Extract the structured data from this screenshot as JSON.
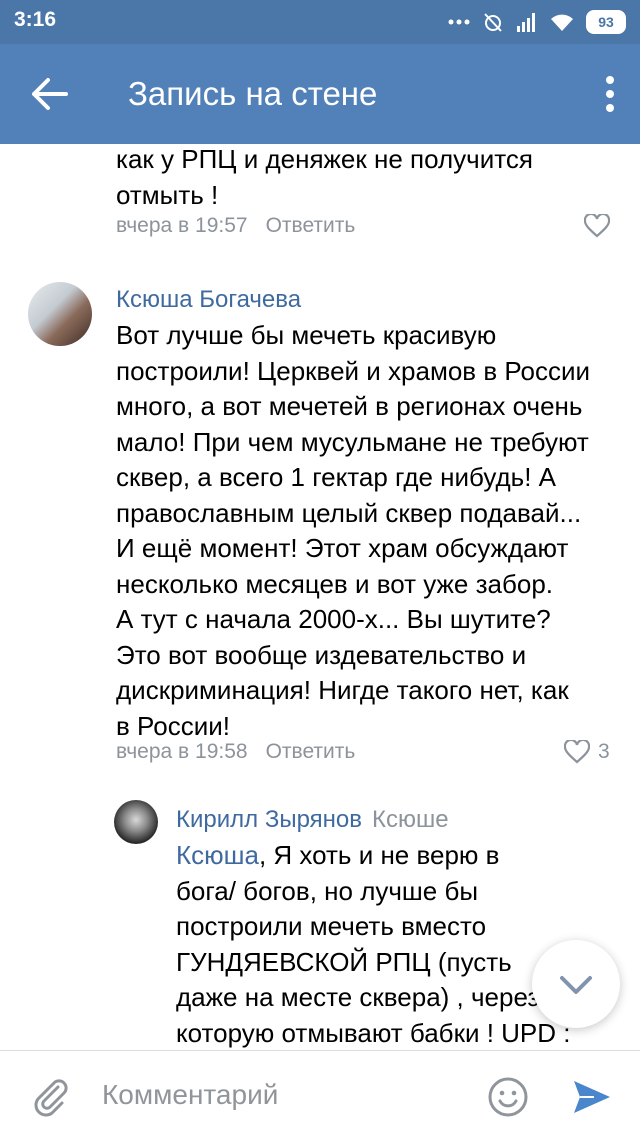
{
  "status": {
    "time": "3:16",
    "battery": "93"
  },
  "header": {
    "title": "Запись на стене"
  },
  "comments": [
    {
      "lines": [
        "как у РПЦ и деняжек не получится",
        "отмыть !"
      ],
      "time": "вчера в 19:57",
      "reply": "Ответить",
      "likes": ""
    },
    {
      "author": "Ксюша Богачева",
      "lines": [
        "Вот лучше бы мечеть красивую",
        "построили! Церквей и храмов в России",
        "много, а вот мечетей в регионах очень",
        "мало! При чем мусульмане не требуют",
        "сквер, а всего 1 гектар где нибудь! А",
        "православным целый сквер подавай...",
        "И ещё момент! Этот храм обсуждают",
        "несколько месяцев и вот уже забор.",
        "А тут с начала 2000-х... Вы шутите?",
        "Это вот вообще издевательство и",
        "дискриминация! Нигде такого нет, как",
        "в России!"
      ],
      "time": "вчера в 19:58",
      "reply": "Ответить",
      "likes": "3"
    },
    {
      "author": "Кирилл Зырянов",
      "reply_to": "Ксюше",
      "mention": "Ксюша",
      "first_line_rest": ", Я хоть и не верю в",
      "lines": [
        "бога/ богов, но лучше бы",
        "построили мечеть вместо",
        "ГУНДЯЕВСКОЙ РПЦ (пусть",
        "даже на месте сквера) , через",
        "которую отмывают бабки ! UPD :"
      ]
    }
  ],
  "composer": {
    "placeholder": "Комментарий"
  },
  "colors": {
    "statusbar": "#4a76a8",
    "toolbar": "#5181b8",
    "link": "#3f6aa0",
    "meta": "#8c939b"
  }
}
